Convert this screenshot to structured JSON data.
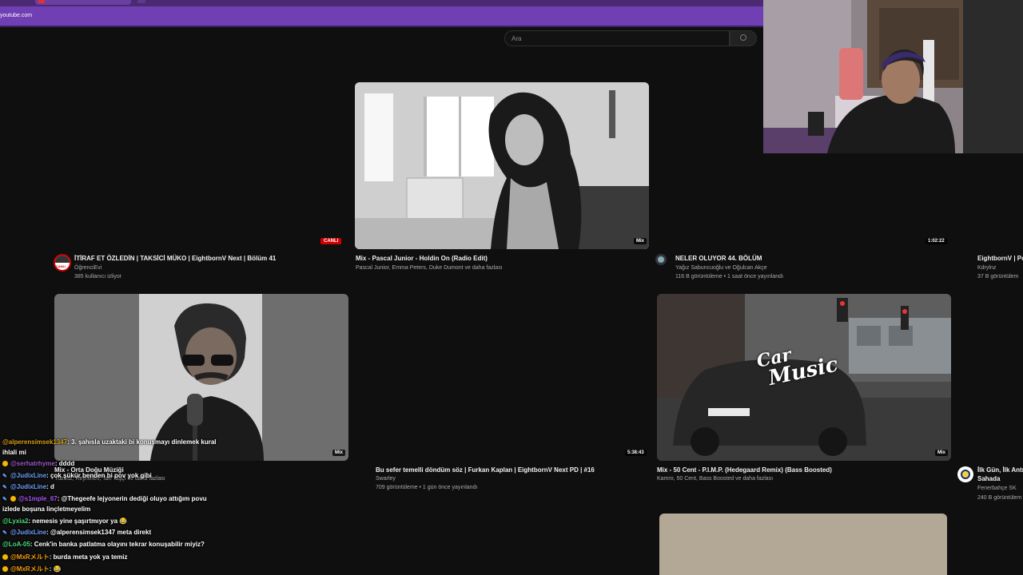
{
  "browser": {
    "url": "youtube.com"
  },
  "search": {
    "placeholder": "Ara"
  },
  "videos": [
    {
      "title": "İTİRAF ET ÖZLEDİN | TAKSİCİ MÜKO | EightbornV Next | Bölüm 41",
      "channel": "ÖğrenciEvi",
      "meta": "385 kullanıcı izliyor",
      "badge": "CANLI",
      "avatar_label": "CANLI"
    },
    {
      "title": "Mix - Pascal Junior - Holdin On (Radio Edit)",
      "channel": "Pascal Junior, Emma Peters, Duke Dumont ve daha fazlası",
      "badge": "Mix"
    },
    {
      "title": "NELER OLUYOR 44. BÖLÜM",
      "channel": "Yağız Sabuncuoğlu ve Oğulcan Akçe",
      "meta": "116 B görüntüleme • 1 saat önce yayınlandı",
      "badge": "1:02:22"
    },
    {
      "title": "EightbornV | Po",
      "channel": "Kdrylnz",
      "meta": "37 B görüntülem"
    },
    {
      "title": "Mix - Orta Doğu Müziği",
      "channel": "Yuzsuz, Reynmen, Tan Taşçı ve daha fazlası",
      "badge": "Mix"
    },
    {
      "title": "Bu sefer temelli döndüm söz | Furkan Kaplan | EightbornV Next PD | #16",
      "channel": "Swarley",
      "meta": "709 görüntüleme • 1 gün önce yayınlandı",
      "badge": "5:38:43"
    },
    {
      "title": "Mix - 50 Cent - P.I.M.P. (Hedegaard Remix) (Bass Boosted)",
      "channel": "Kamro, 50 Cent, Bass Boosted ve daha fazlası",
      "badge": "Mix"
    },
    {
      "title": "İlk Gün, İlk Antr",
      "title2": "Sahada",
      "channel": "Fenerbahçe SK",
      "meta": "240 B görüntülem"
    }
  ],
  "car_logo": {
    "line1": "Car",
    "line2": "Music"
  },
  "chat": [
    {
      "user": "@alperensimsek1347",
      "user_color": "#d4a017",
      "message": ": 3. şahısla uzaktaki bi konuşmayı dinlemek kural"
    },
    {
      "user": "",
      "user_color": "#ffffff",
      "message": "ihlali mi"
    },
    {
      "user": "@serhatrhyme",
      "user_color": "#9b59d0",
      "message": ": dddd",
      "icon": "coin-icon"
    },
    {
      "user": "@JudixLine",
      "user_color": "#6fa2ff",
      "message": ": çok şükür benden bi pov yok gibi",
      "icon": "wrench-icon"
    },
    {
      "user": "@JudixLine",
      "user_color": "#6fa2ff",
      "message": ": d",
      "icon": "wrench-icon"
    },
    {
      "user": "@s1mple_67",
      "user_color": "#a855f7",
      "message": ": @Thegeefe lejyonerin dediği oluyo attığım povu",
      "icon": "wrench-coin-icon"
    },
    {
      "user": "",
      "user_color": "#ffffff",
      "message": "izlede boşuna linçletmeyelim"
    },
    {
      "user": "@Lyxia2",
      "user_color": "#4ade80",
      "message": ": nemesis yine şaşırtmıyor ya 😂"
    },
    {
      "user": "@JudixLine",
      "user_color": "#6fa2ff",
      "message": ": @alperensimsek1347 meta direkt",
      "icon": "wrench-icon"
    },
    {
      "user": "@LoA-05",
      "user_color": "#4ade80",
      "message": ": Cenk'in banka patlatma olayını tekrar konuşabilir miyiz?"
    },
    {
      "user": "@MxRメルト",
      "user_color": "#f59e0b",
      "message": ": burda meta yok ya temiz",
      "icon": "coin-icon"
    },
    {
      "user": "@MxRメルト",
      "user_color": "#f59e0b",
      "message": ": 😂",
      "icon": "coin-icon"
    }
  ]
}
